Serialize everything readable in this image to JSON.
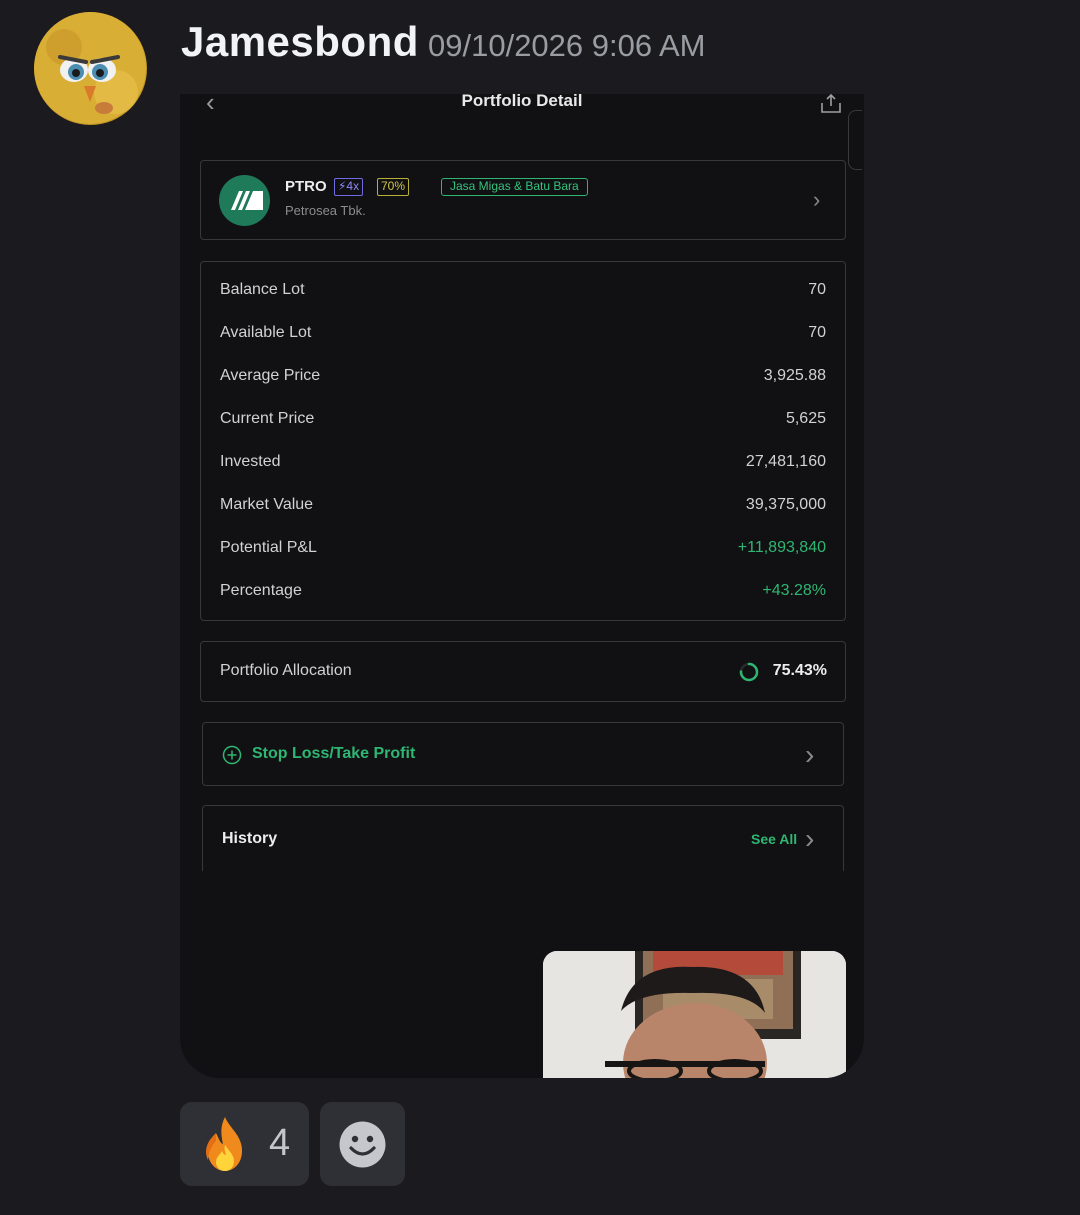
{
  "message": {
    "username": "Jamesbond",
    "timestamp": "09/10/2026 9:06 AM"
  },
  "app": {
    "title": "Portfolio Detail",
    "stock": {
      "ticker": "PTRO",
      "leverage_badge": "⚡4x",
      "percent_badge": "70%",
      "sector_badge": "Jasa Migas & Batu Bara",
      "company": "Petrosea Tbk."
    },
    "details": [
      {
        "label": "Balance Lot",
        "value": "70"
      },
      {
        "label": "Available Lot",
        "value": "70"
      },
      {
        "label": "Average Price",
        "value": "3,925.88"
      },
      {
        "label": "Current Price",
        "value": "5,625"
      },
      {
        "label": "Invested",
        "value": "27,481,160"
      },
      {
        "label": "Market Value",
        "value": "39,375,000"
      },
      {
        "label": "Potential P&L",
        "value": "+11,893,840"
      },
      {
        "label": "Percentage",
        "value": "+43.28%"
      }
    ],
    "allocation": {
      "label": "Portfolio Allocation",
      "value": "75.43%",
      "fraction": 0.7543
    },
    "stop_loss": {
      "label": "Stop Loss/Take Profit"
    },
    "history": {
      "label": "History",
      "see_all": "See All"
    }
  },
  "reactions": [
    {
      "icon": "fire-emoji-icon",
      "count": "4"
    },
    {
      "icon": "add-reaction-smile-icon"
    }
  ],
  "colors": {
    "background": "#1b1b1f",
    "accent_green": "#2fb673",
    "reaction_bg": "#2f3035"
  }
}
